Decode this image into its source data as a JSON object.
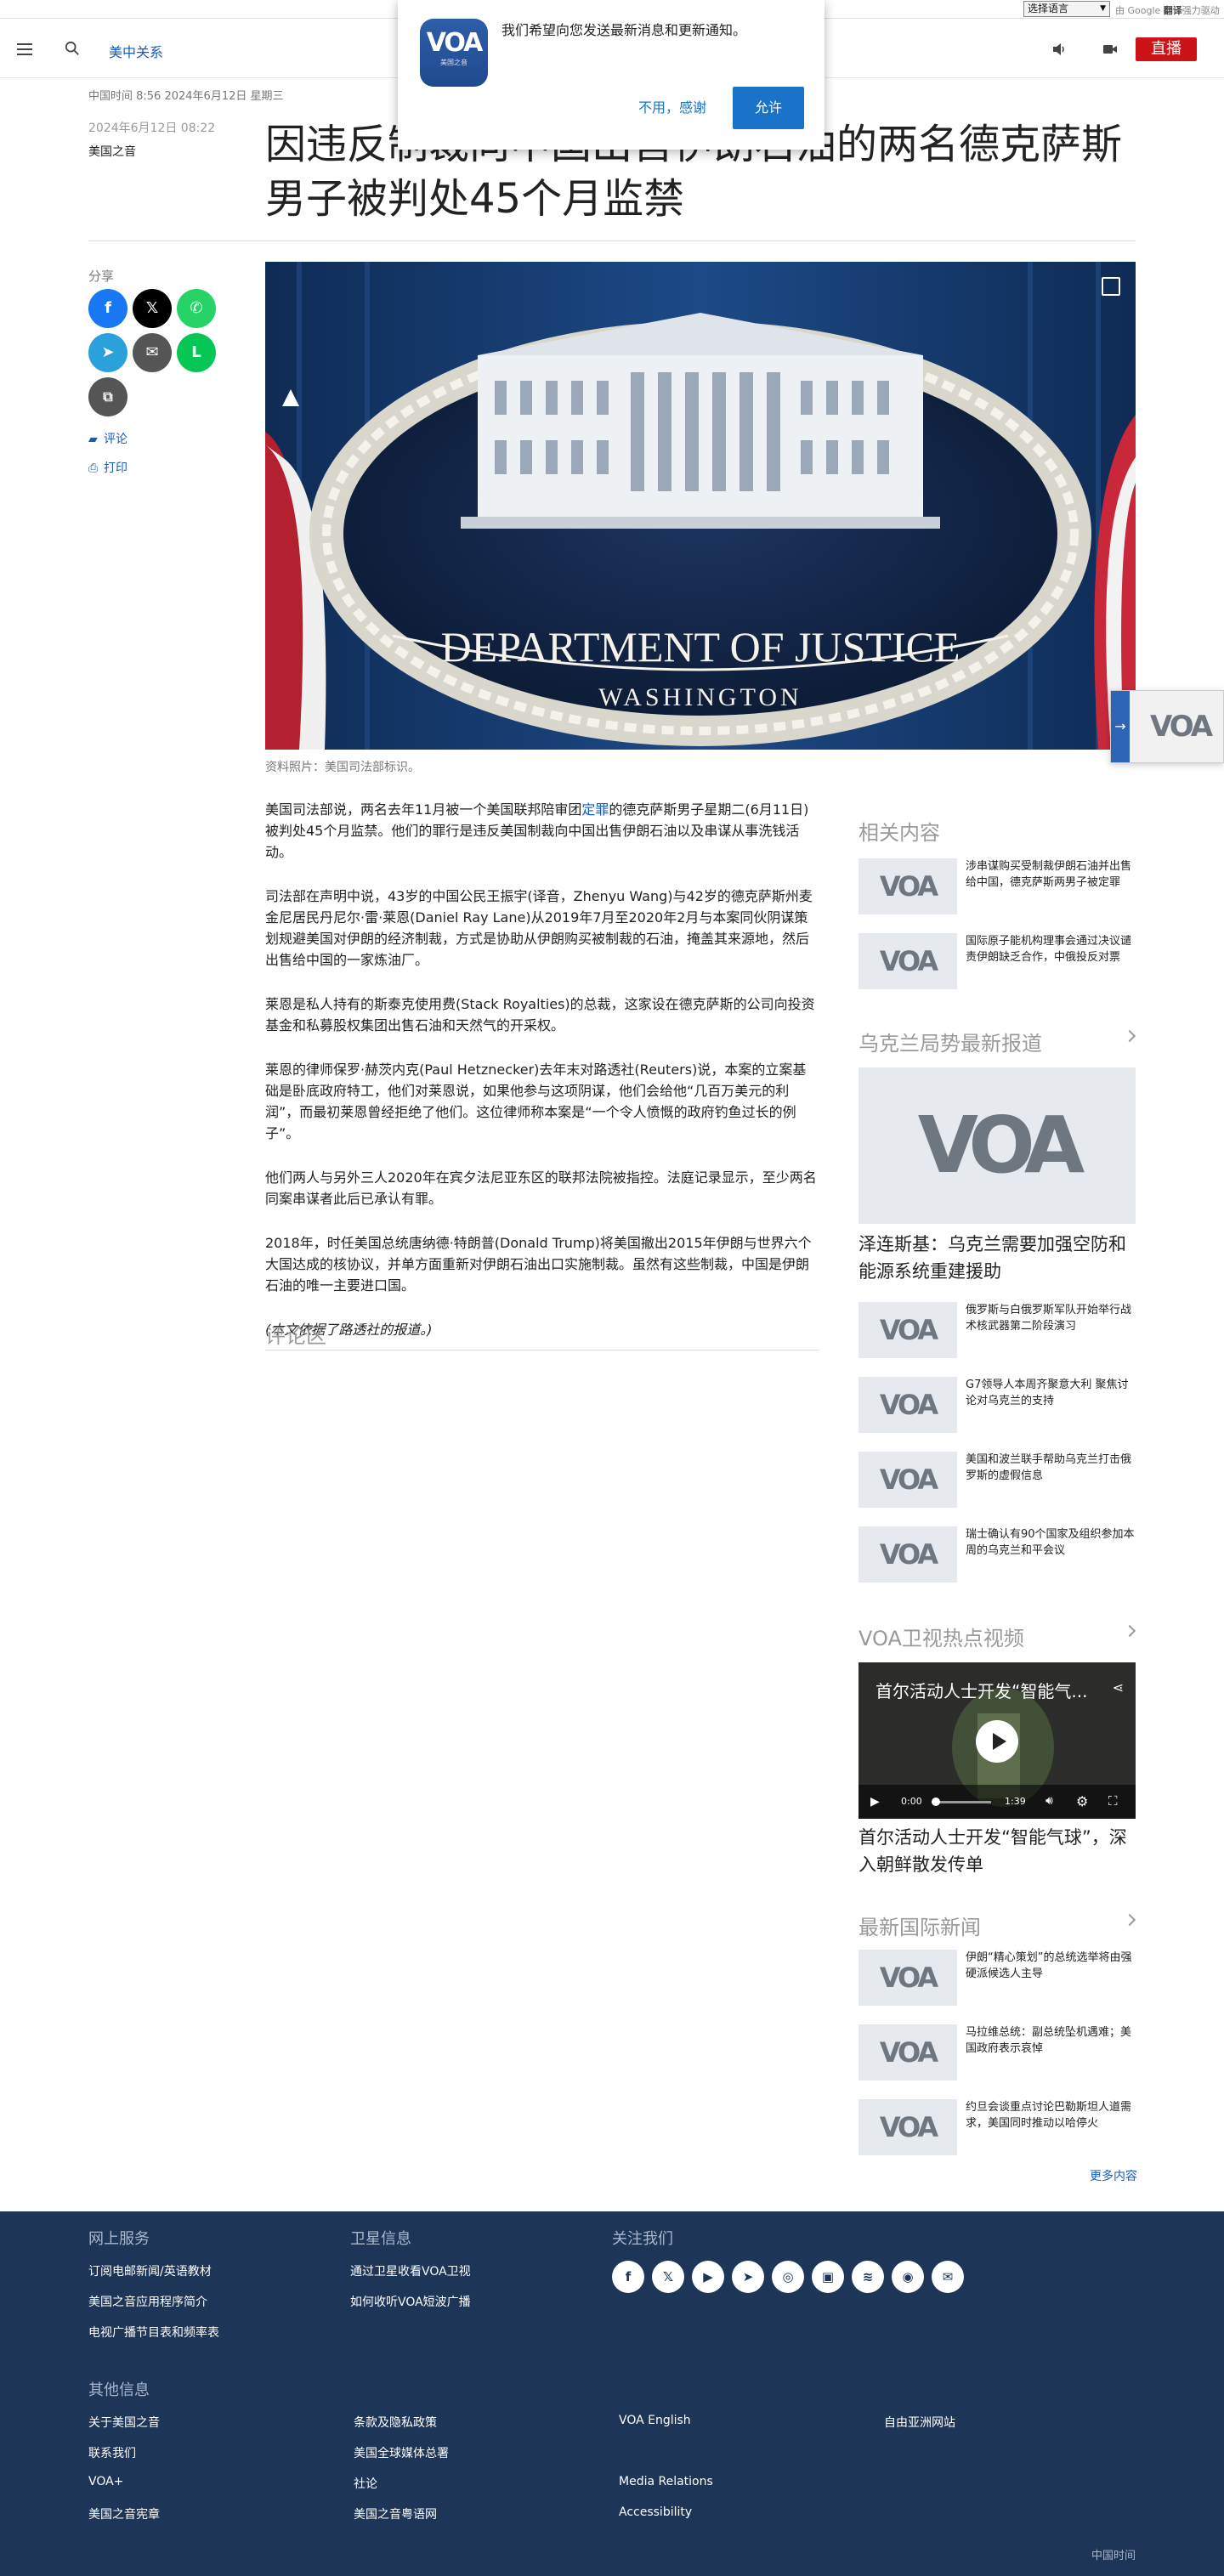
{
  "topbar": {
    "language_select": "选择语言",
    "gt_prefix": "由 Google",
    "gt_bold": "翻译",
    "gt_suffix": "强力驱动"
  },
  "header": {
    "section": "美中关系",
    "live": "直播"
  },
  "notification": {
    "message": "我们希望向您发送最新消息和更新通知。",
    "decline": "不用，感谢",
    "allow": "允许",
    "logo_text": "VOA",
    "logo_sub": "美国之音"
  },
  "article": {
    "meta_top": "中国时间 8:56 2024年6月12日 星期三",
    "date": "2024年6月12日 08:22",
    "source": "美国之音",
    "title": "因违反制裁向中国出售伊朗石油的两名德克萨斯男子被判处45个月监禁",
    "hero_seal_line1": "DEPARTMENT OF JUSTICE",
    "hero_seal_line2": "WASHINGTON",
    "caption": "资料照片：美国司法部标识。",
    "p1_a": "美国司法部说，两名去年11月被一个美国联邦陪审团",
    "p1_link": "定罪",
    "p1_b": "的德克萨斯男子星期二(6月11日)被判处45个月监禁。他们的罪行是违反美国制裁向中国出售伊朗石油以及串谋从事洗钱活动。",
    "p2": "司法部在声明中说，43岁的中国公民王振宇(译音，Zhenyu Wang)与42岁的德克萨斯州麦金尼居民丹尼尔·雷·莱恩(Daniel Ray Lane)从2019年7月至2020年2月与本案同伙阴谋策划规避美国对伊朗的经济制裁，方式是协助从伊朗购买被制裁的石油，掩盖其来源地，然后出售给中国的一家炼油厂。",
    "p3": "莱恩是私人持有的斯泰克使用费(Stack Royalties)的总裁，这家设在德克萨斯的公司向投资基金和私募股权集团出售石油和天然气的开采权。",
    "p4": "莱恩的律师保罗·赫茨内克(Paul Hetznecker)去年末对路透社(Reuters)说，本案的立案基础是卧底政府特工，他们对莱恩说，如果他参与这项阴谋，他们会给他“几百万美元的利润”，而最初莱恩曾经拒绝了他们。这位律师称本案是“一个令人愤慨的政府钓鱼过长的例子”。",
    "p5": "他们两人与另外三人2020年在宾夕法尼亚东区的联邦法院被指控。法庭记录显示，至少两名同案串谋者此后已承认有罪。",
    "p6": "2018年，时任美国总统唐纳德·特朗普(Donald Trump)将美国撤出2015年伊朗与世界六个大国达成的核协议，并单方面重新对伊朗石油出口实施制裁。虽然有这些制裁，中国是伊朗石油的唯一主要进口国。",
    "p7": "(本文依据了路透社的报道。)",
    "comments": "评论区"
  },
  "share": {
    "label": "分享",
    "comment": "评论",
    "print": "打印"
  },
  "sidebar": {
    "related_title": "相关内容",
    "related": [
      {
        "text": "涉串谋购买受制裁伊朗石油并出售给中国，德克萨斯两男子被定罪"
      },
      {
        "text": "国际原子能机构理事会通过决议谴责伊朗缺乏合作，中俄投反对票"
      }
    ],
    "ukraine_title": "乌克兰局势最新报道",
    "ukraine_main": "泽连斯基：乌克兰需要加强空防和能源系统重建援助",
    "ukraine": [
      {
        "text": "俄罗斯与白俄罗斯军队开始举行战术核武器第二阶段演习"
      },
      {
        "text": "G7领导人本周齐聚意大利 聚焦讨论对乌克兰的支持"
      },
      {
        "text": "美国和波兰联手帮助乌克兰打击俄罗斯的虚假信息"
      },
      {
        "text": "瑞士确认有90个国家及组织参加本周的乌克兰和平会议"
      }
    ],
    "video_title": "VOA卫视热点视频",
    "video_overlay": "首尔活动人士开发“智能气...",
    "video_time_start": "0:00",
    "video_time_end": "1:39",
    "video_caption": "首尔活动人士开发“智能气球”，深入朝鲜散发传单",
    "intl_title": "最新国际新闻",
    "intl": [
      {
        "text": "伊朗“精心策划”的总统选举将由强硬派候选人主导"
      },
      {
        "text": "马拉维总统：副总统坠机遇难；美国政府表示哀悼"
      },
      {
        "text": "约旦会谈重点讨论巴勒斯坦人道需求，美国同时推动以哈停火"
      }
    ],
    "more": "更多内容",
    "thumb_logo": "VOA"
  },
  "footer": {
    "online_title": "网上服务",
    "online": [
      "订阅电邮新闻/英语教材",
      "美国之音应用程序简介",
      "电视广播节目表和频率表"
    ],
    "sat_title": "卫星信息",
    "sat": [
      "通过卫星收看VOA卫视",
      "如何收听VOA短波广播"
    ],
    "follow_title": "关注我们",
    "other_title": "其他信息",
    "col1": [
      "关于美国之音",
      "联系我们",
      "VOA+",
      "美国之音宪章"
    ],
    "col2": [
      "条款及隐私政策",
      "美国全球媒体总署",
      "社论",
      "美国之音粤语网"
    ],
    "col3": [
      "VOA English",
      "",
      "Media Relations",
      "Accessibility"
    ],
    "col4": [
      "自由亚洲网站"
    ],
    "china_time": "中国时间"
  },
  "colors": {
    "brand_blue": "#1a5ab8",
    "live_red": "#cc1418",
    "footer_bg": "#1d3556"
  }
}
